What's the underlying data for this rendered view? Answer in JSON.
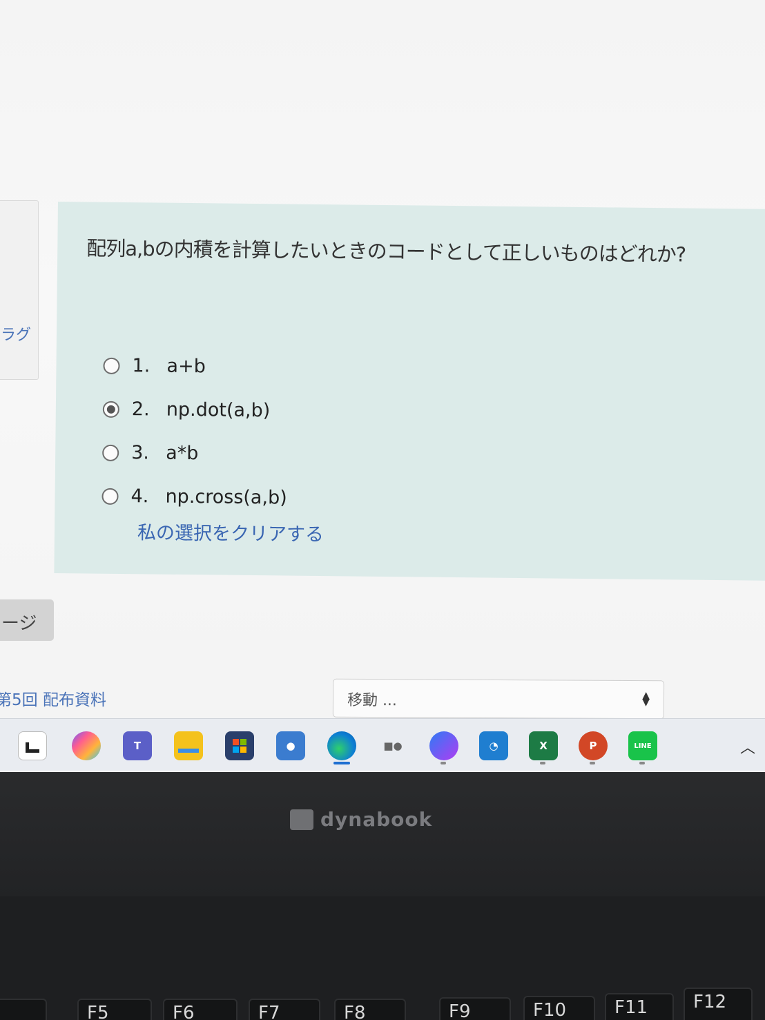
{
  "question": {
    "text": "配列a,bの内積を計算したいときのコードとして正しいものはどれか?",
    "answers": [
      {
        "num": "1.",
        "label": "a+b",
        "checked": false
      },
      {
        "num": "2.",
        "label": "np.dot(a,b)",
        "checked": true
      },
      {
        "num": "3.",
        "label": "a*b",
        "checked": false
      },
      {
        "num": "4.",
        "label": "np.cross(a,b)",
        "checked": false
      }
    ],
    "clear_link": "私の選択をクリアする"
  },
  "left_panel": {
    "label": "ラグ"
  },
  "navigation": {
    "page_button": "ージ",
    "prev_activity": "第5回 配布資料",
    "jump_select": "移動 ..."
  },
  "taskbar": {
    "icons": [
      "start-icon",
      "copilot-icon",
      "teams-icon",
      "file-explorer-icon",
      "store-icon",
      "app-icon",
      "edge-icon",
      "camera-icon",
      "loop-icon",
      "speedtest-icon",
      "excel-icon",
      "powerpoint-icon",
      "line-icon"
    ]
  },
  "hardware": {
    "brand": "dynabook",
    "keys": [
      "F5",
      "F6",
      "F7",
      "F8",
      "F9",
      "F10",
      "F11",
      "F12"
    ]
  }
}
